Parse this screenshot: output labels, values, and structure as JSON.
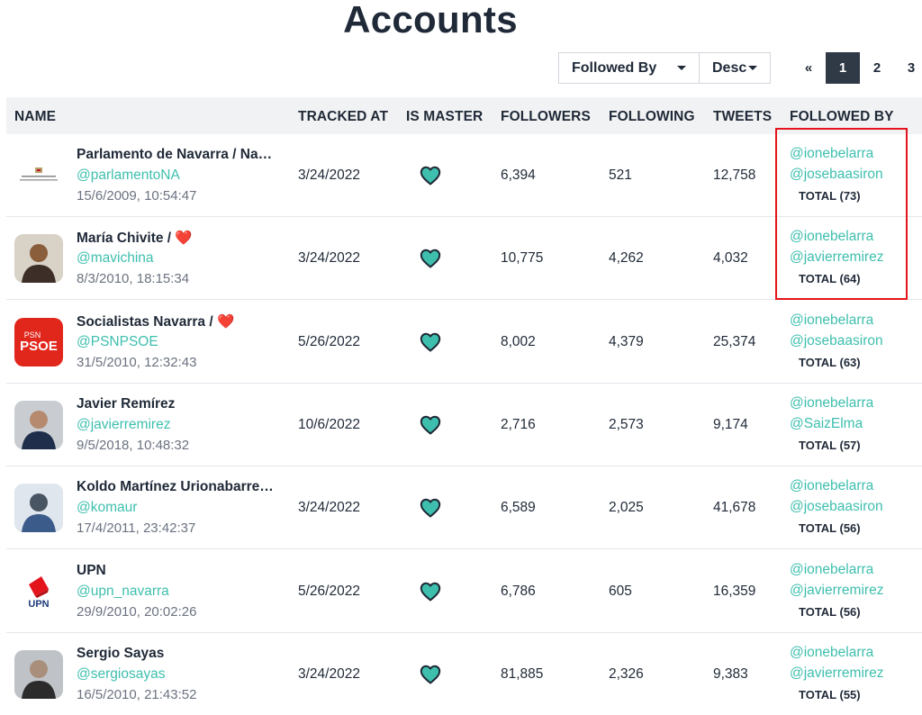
{
  "page_title": "Accounts",
  "controls": {
    "followed_by_label": "Followed By",
    "order_label": "Desc",
    "pagination": {
      "prev": "«",
      "pages": [
        "1",
        "2",
        "3"
      ],
      "active": "1"
    }
  },
  "columns": {
    "name": "NAME",
    "tracked_at": "TRACKED AT",
    "is_master": "IS MASTER",
    "followers": "FOLLOWERS",
    "following": "FOLLOWING",
    "tweets": "TWEETS",
    "followed_by": "FOLLOWED BY"
  },
  "colors": {
    "accent": "#3ebfae",
    "header_bg": "#f1f2f3",
    "highlight": "#e3141b",
    "active_page": "#2f3a46"
  },
  "rows": [
    {
      "name": "Parlamento de Navarra / Na…",
      "handle": "@parlamentoNA",
      "created": "15/6/2009, 10:54:47",
      "tracked_at": "3/24/2022",
      "followers": "6,394",
      "following": "521",
      "tweets": "12,758",
      "followed_by": [
        "@ionebelarra",
        "@josebaasiron"
      ],
      "total": "TOTAL (73)",
      "avatar": "parliament-logo"
    },
    {
      "name": "María Chivite / ❤️",
      "handle": "@mavichina",
      "created": "8/3/2010, 18:15:34",
      "tracked_at": "3/24/2022",
      "followers": "10,775",
      "following": "4,262",
      "tweets": "4,032",
      "followed_by": [
        "@ionebelarra",
        "@javierremirez"
      ],
      "total": "TOTAL (64)",
      "avatar": "person-photo"
    },
    {
      "name": "Socialistas Navarra / ❤️",
      "handle": "@PSNPSOE",
      "created": "31/5/2010, 12:32:43",
      "tracked_at": "5/26/2022",
      "followers": "8,002",
      "following": "4,379",
      "tweets": "25,374",
      "followed_by": [
        "@ionebelarra",
        "@josebaasiron"
      ],
      "total": "TOTAL (63)",
      "avatar": "psoe-logo",
      "avatar_text": [
        "PSN",
        "PSOE"
      ]
    },
    {
      "name": "Javier Remírez",
      "handle": "@javierremirez",
      "created": "9/5/2018, 10:48:32",
      "tracked_at": "10/6/2022",
      "followers": "2,716",
      "following": "2,573",
      "tweets": "9,174",
      "followed_by": [
        "@ionebelarra",
        "@SaizElma"
      ],
      "total": "TOTAL (57)",
      "avatar": "person-photo"
    },
    {
      "name": "Koldo Martínez Urionabarre…",
      "handle": "@komaur",
      "created": "17/4/2011, 23:42:37",
      "tracked_at": "3/24/2022",
      "followers": "6,589",
      "following": "2,025",
      "tweets": "41,678",
      "followed_by": [
        "@ionebelarra",
        "@josebaasiron"
      ],
      "total": "TOTAL (56)",
      "avatar": "person-photo"
    },
    {
      "name": "UPN",
      "handle": "@upn_navarra",
      "created": "29/9/2010, 20:02:26",
      "tracked_at": "5/26/2022",
      "followers": "6,786",
      "following": "605",
      "tweets": "16,359",
      "followed_by": [
        "@ionebelarra",
        "@javierremirez"
      ],
      "total": "TOTAL (56)",
      "avatar": "upn-logo",
      "avatar_text": [
        "UPN"
      ]
    },
    {
      "name": "Sergio Sayas",
      "handle": "@sergiosayas",
      "created": "16/5/2010, 21:43:52",
      "tracked_at": "3/24/2022",
      "followers": "81,885",
      "following": "2,326",
      "tweets": "9,383",
      "followed_by": [
        "@ionebelarra",
        "@javierremirez"
      ],
      "total": "TOTAL (55)",
      "avatar": "person-photo"
    }
  ]
}
